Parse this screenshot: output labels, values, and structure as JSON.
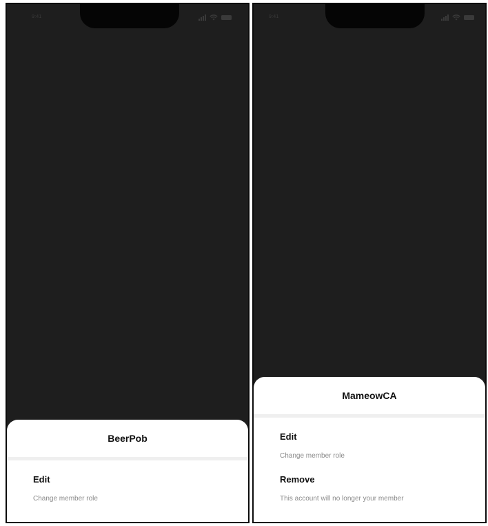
{
  "left_screen": {
    "status_bar": {
      "time": "9:41",
      "icons": [
        "signal-icon",
        "wifi-icon",
        "battery-icon"
      ]
    },
    "sheet": {
      "title": "BeerPob",
      "items": [
        {
          "label": "Edit",
          "description": "Change member role"
        }
      ]
    }
  },
  "right_screen": {
    "status_bar": {
      "time": "9:41",
      "icons": [
        "signal-icon",
        "wifi-icon",
        "battery-icon"
      ]
    },
    "sheet": {
      "title": "MameowCA",
      "items": [
        {
          "label": "Edit",
          "description": "Change member role"
        },
        {
          "label": "Remove",
          "description": "This account will no longer your member"
        }
      ]
    }
  },
  "colors": {
    "backdrop": "#1e1e1e",
    "sheet_background": "#ffffff",
    "title_text": "#111111",
    "description_text": "#8a8a8a",
    "divider": "#efefef"
  }
}
